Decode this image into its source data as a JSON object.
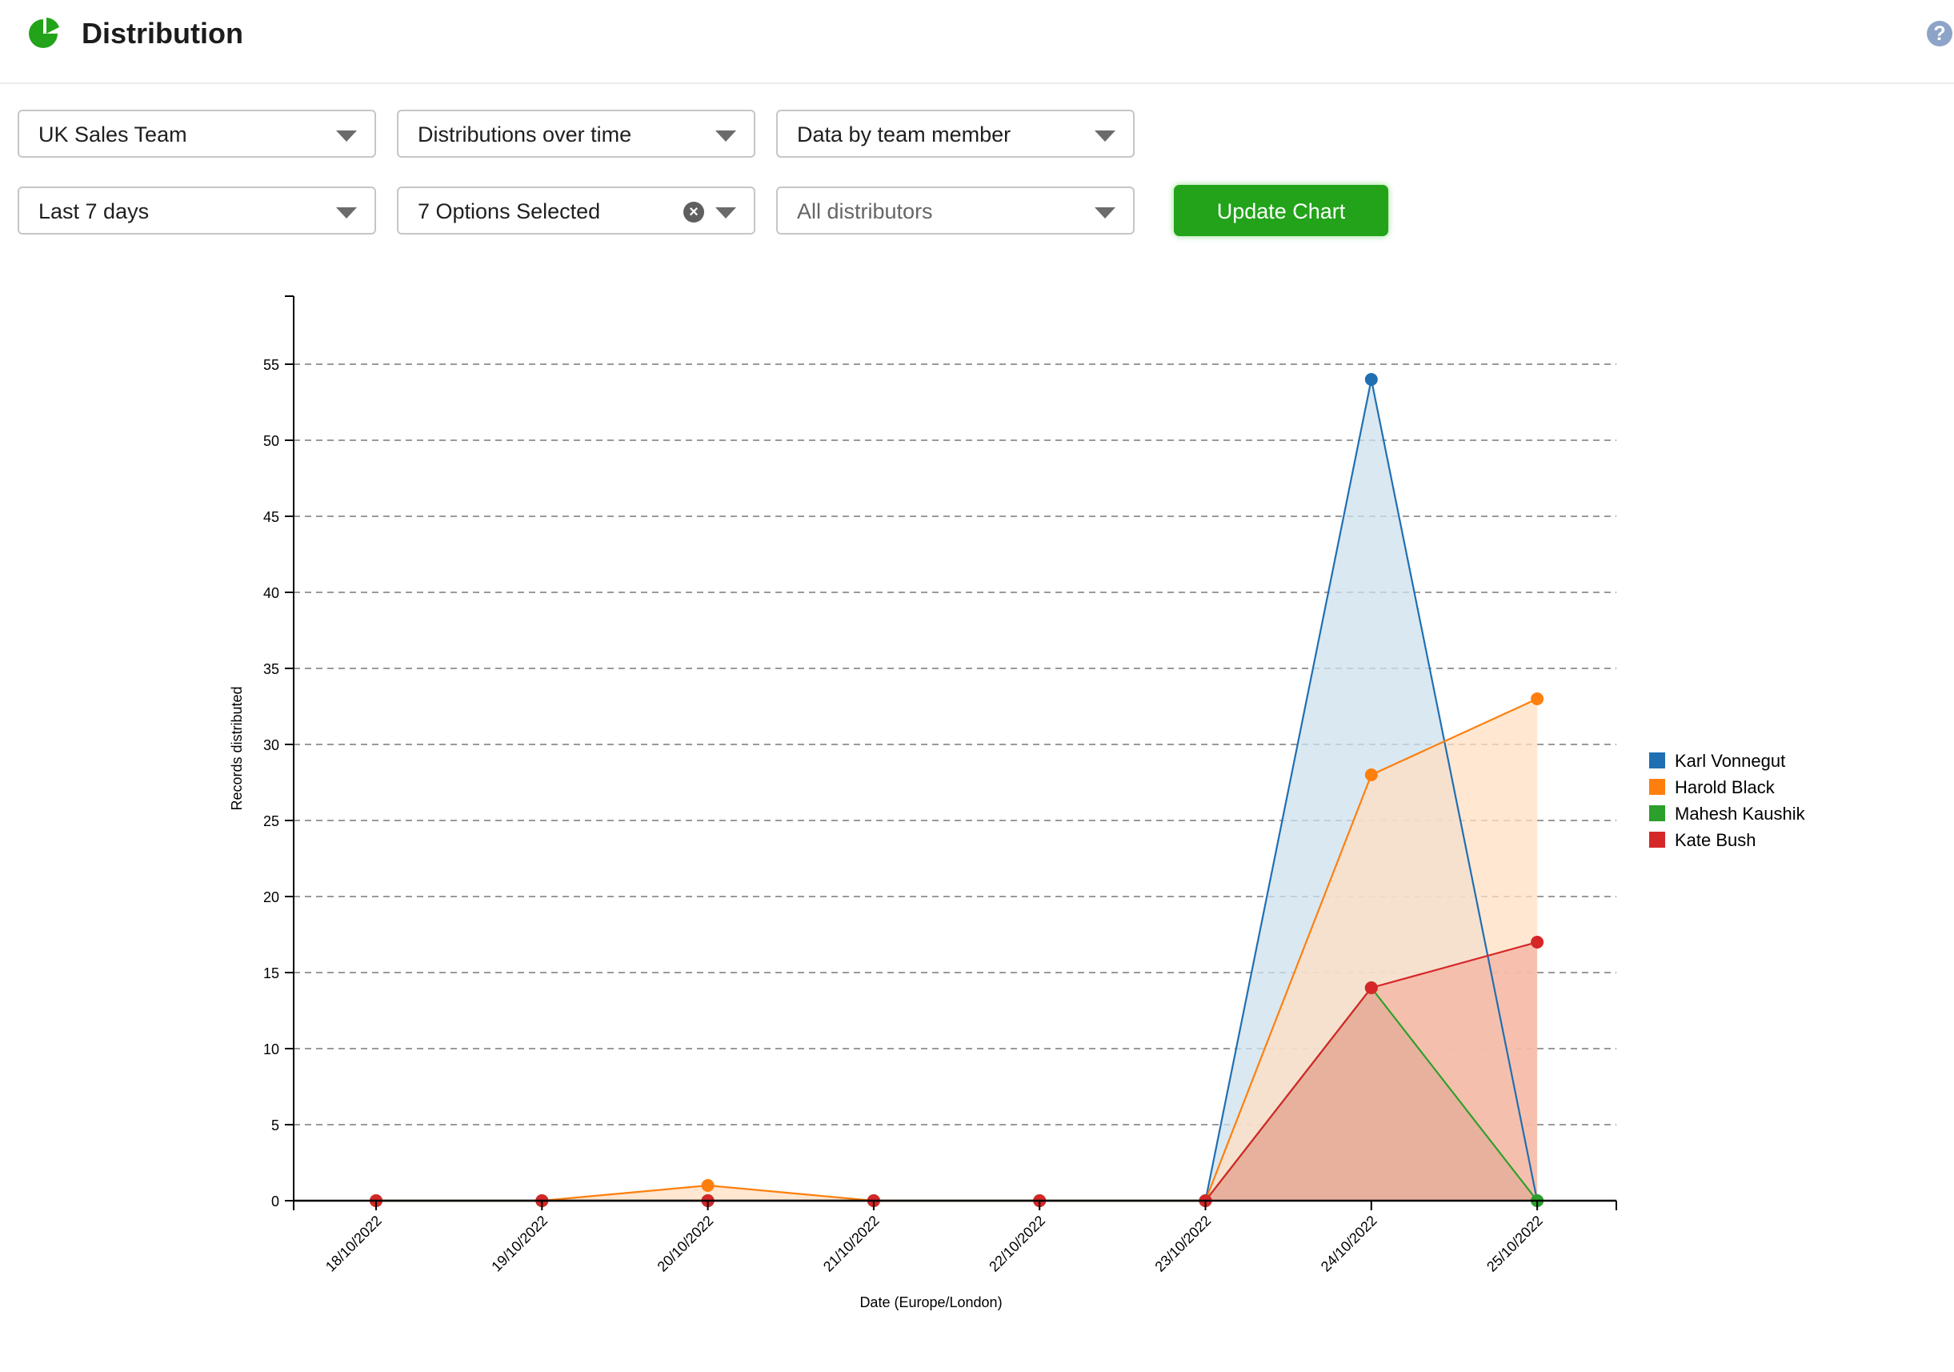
{
  "header": {
    "title": "Distribution",
    "help_icon": "question-circle-icon",
    "logo_icon": "pie-chart-icon"
  },
  "filters": {
    "row1": [
      {
        "name": "team-select",
        "value": "UK Sales Team"
      },
      {
        "name": "report-type-select",
        "value": "Distributions over time"
      },
      {
        "name": "grouping-select",
        "value": "Data by team member"
      }
    ],
    "row2": [
      {
        "name": "date-range-select",
        "value": "Last 7 days"
      },
      {
        "name": "options-multiselect",
        "value": "7 Options Selected",
        "clearable": true
      },
      {
        "name": "distributors-select",
        "placeholder": "All distributors"
      }
    ],
    "update_button": "Update Chart"
  },
  "colors": {
    "accent": "#22a31a",
    "help": "#8da4c8"
  },
  "chart_data": {
    "type": "area",
    "title": "",
    "xlabel": "Date (Europe/London)",
    "ylabel": "Records distributed",
    "categories": [
      "18/10/2022",
      "19/10/2022",
      "20/10/2022",
      "21/10/2022",
      "22/10/2022",
      "23/10/2022",
      "24/10/2022",
      "25/10/2022"
    ],
    "yticks": [
      0,
      5,
      10,
      15,
      20,
      25,
      30,
      35,
      40,
      45,
      50,
      55
    ],
    "ylim": [
      0,
      59.5
    ],
    "grid": true,
    "legend_position": "right",
    "series": [
      {
        "name": "Karl Vonnegut",
        "color": "#1f6fb2",
        "fill": "#cde0ee",
        "values": [
          0,
          0,
          0,
          0,
          0,
          0,
          54,
          0
        ]
      },
      {
        "name": "Harold Black",
        "color": "#ff7f0e",
        "fill": "#ffdfc3",
        "values": [
          0,
          0,
          1,
          0,
          0,
          0,
          28,
          33
        ]
      },
      {
        "name": "Mahesh Kaushik",
        "color": "#2ca02c",
        "fill": "#b39a7c",
        "values": [
          0,
          0,
          0,
          0,
          0,
          0,
          14,
          0
        ]
      },
      {
        "name": "Kate Bush",
        "color": "#d62728",
        "fill": "#f4b3a2",
        "values": [
          0,
          0,
          0,
          0,
          0,
          0,
          14,
          17
        ]
      }
    ]
  }
}
